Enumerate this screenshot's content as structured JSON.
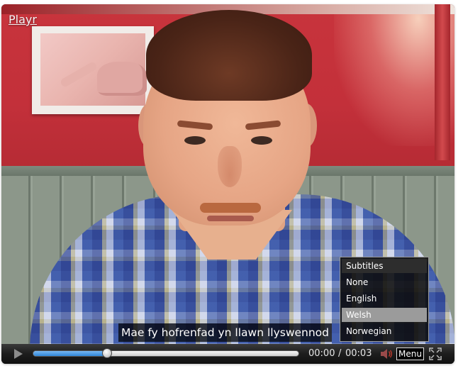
{
  "player": {
    "brand_label": "Playr",
    "subtitle_text": "Mae fy hofrenfad yn llawn llyswennod"
  },
  "subtitles_menu": {
    "title": "Subtitles",
    "options": [
      {
        "label": "None",
        "selected": false
      },
      {
        "label": "English",
        "selected": false
      },
      {
        "label": "Welsh",
        "selected": true
      },
      {
        "label": "Norwegian",
        "selected": false
      }
    ]
  },
  "controls": {
    "current_time": "00:00",
    "separator": "/",
    "duration": "00:03",
    "progress": 0.28,
    "menu_label": "Menu",
    "play_icon": "play-icon",
    "volume_icon": "volume-muted-icon",
    "fullscreen_icon": "fullscreen-icon",
    "colors": {
      "progress_fill": "#2f86d8",
      "bar_background": "#1d1d1d",
      "menu_selected": "#9b9b9b",
      "volume_muted": "#c0392b"
    }
  }
}
